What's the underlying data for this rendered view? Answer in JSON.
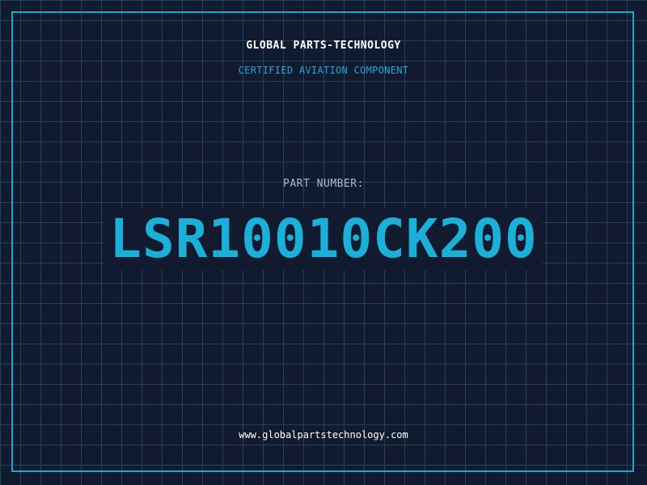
{
  "header": {
    "company": "GLOBAL PARTS-TECHNOLOGY",
    "tagline": "CERTIFIED AVIATION COMPONENT"
  },
  "part": {
    "label": "PART NUMBER:",
    "number": "LSR10010CK200"
  },
  "footer": {
    "website": "www.globalpartstechnology.com"
  },
  "colors": {
    "background": "#111a2e",
    "grid": "#1d4558",
    "accent": "#1ab0d8",
    "border": "#1aa8c8"
  }
}
